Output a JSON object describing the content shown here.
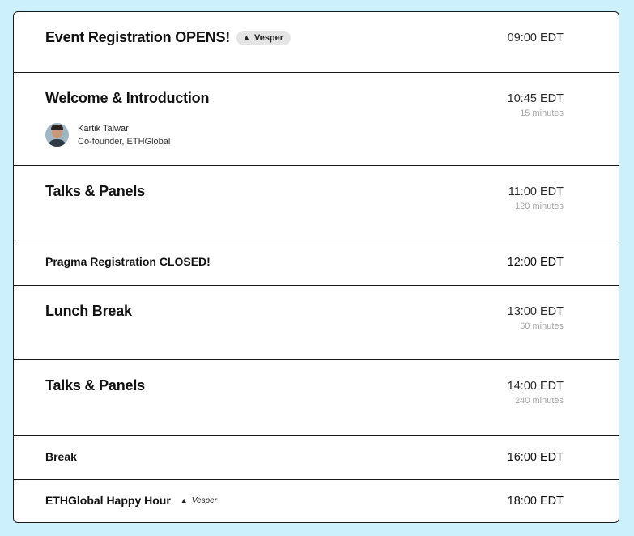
{
  "schedule": [
    {
      "title": "Event Registration OPENS!",
      "badge": "Vesper",
      "time": "09:00 EDT"
    },
    {
      "title": "Welcome & Introduction",
      "time": "10:45 EDT",
      "duration": "15 minutes",
      "speaker": {
        "name": "Kartik Talwar",
        "role": "Co-founder, ETHGlobal"
      }
    },
    {
      "title": "Talks & Panels",
      "time": "11:00 EDT",
      "duration": "120 minutes"
    },
    {
      "title": "Pragma Registration CLOSED!",
      "time": "12:00 EDT"
    },
    {
      "title": "Lunch Break",
      "time": "13:00 EDT",
      "duration": "60 minutes"
    },
    {
      "title": "Talks & Panels",
      "time": "14:00 EDT",
      "duration": "240 minutes"
    },
    {
      "title": "Break",
      "time": "16:00 EDT"
    },
    {
      "title": "ETHGlobal Happy Hour",
      "badge": "Vesper",
      "time": "18:00 EDT"
    }
  ]
}
